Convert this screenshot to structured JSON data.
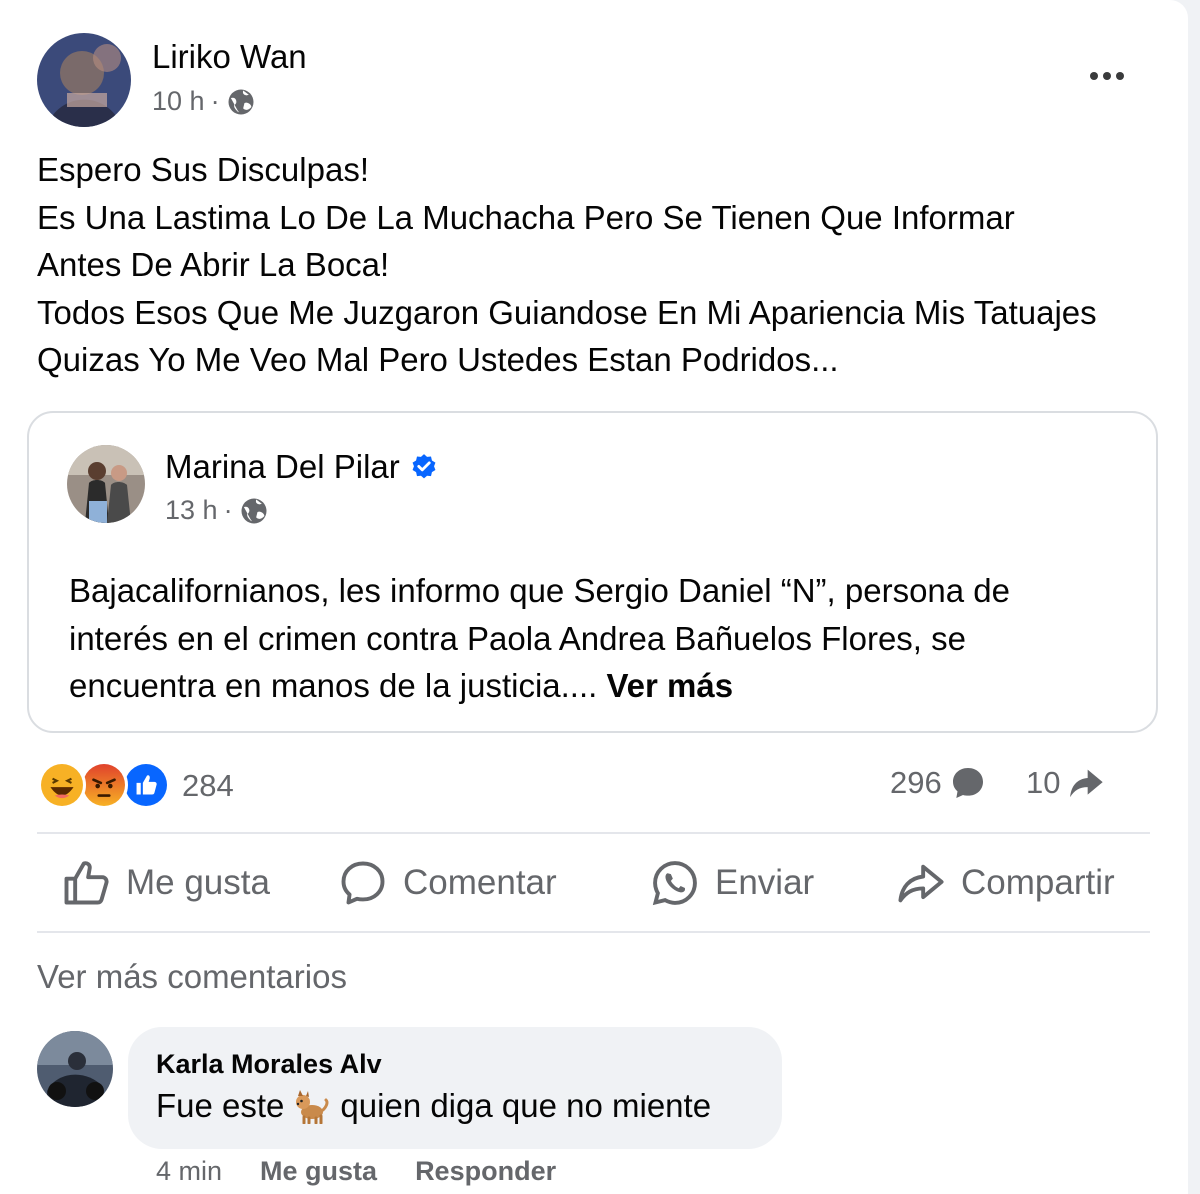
{
  "post": {
    "author": "Liriko Wan",
    "time": "10 h",
    "separator": "·",
    "audience_icon": "globe-icon",
    "text_lines": [
      "Espero Sus Disculpas!",
      "Es Una Lastima Lo De La Muchacha Pero Se Tienen Que Informar",
      "Antes De Abrir La Boca!",
      "Todos Esos Que Me Juzgaron Guiandose En Mi Apariencia Mis Tatuajes",
      "Quizas Yo Me Veo Mal Pero Ustedes Estan Podridos..."
    ]
  },
  "shared_post": {
    "author": "Marina Del Pilar",
    "verified": true,
    "time": "13 h",
    "separator": "·",
    "text_lines": [
      "Bajacalifornianos, les informo que Sergio Daniel “N”, persona de",
      "interés en el crimen contra Paola Andrea Bañuelos Flores, se",
      "encuentra en manos de la justicia...."
    ],
    "see_more": "Ver más"
  },
  "stats": {
    "reactions": [
      "haha-icon",
      "angry-icon",
      "like-icon"
    ],
    "reaction_count": "284",
    "comments_count": "296",
    "shares_count": "10"
  },
  "actions": {
    "like": "Me gusta",
    "comment": "Comentar",
    "send": "Enviar",
    "share": "Compartir"
  },
  "comments_section": {
    "view_more": "Ver más comentarios",
    "comments": [
      {
        "author": "Karla Morales Alv",
        "text_before": "Fue este",
        "emoji": "dog-emoji",
        "text_after": "quien diga que no miente",
        "time": "4 min",
        "like": "Me gusta",
        "reply": "Responder"
      }
    ]
  },
  "colors": {
    "verified": "#0866ff",
    "like_reaction": "#0866ff",
    "angry_reaction": "#e9710f",
    "haha_reaction": "#f7b125",
    "secondary_text": "#65676b"
  }
}
